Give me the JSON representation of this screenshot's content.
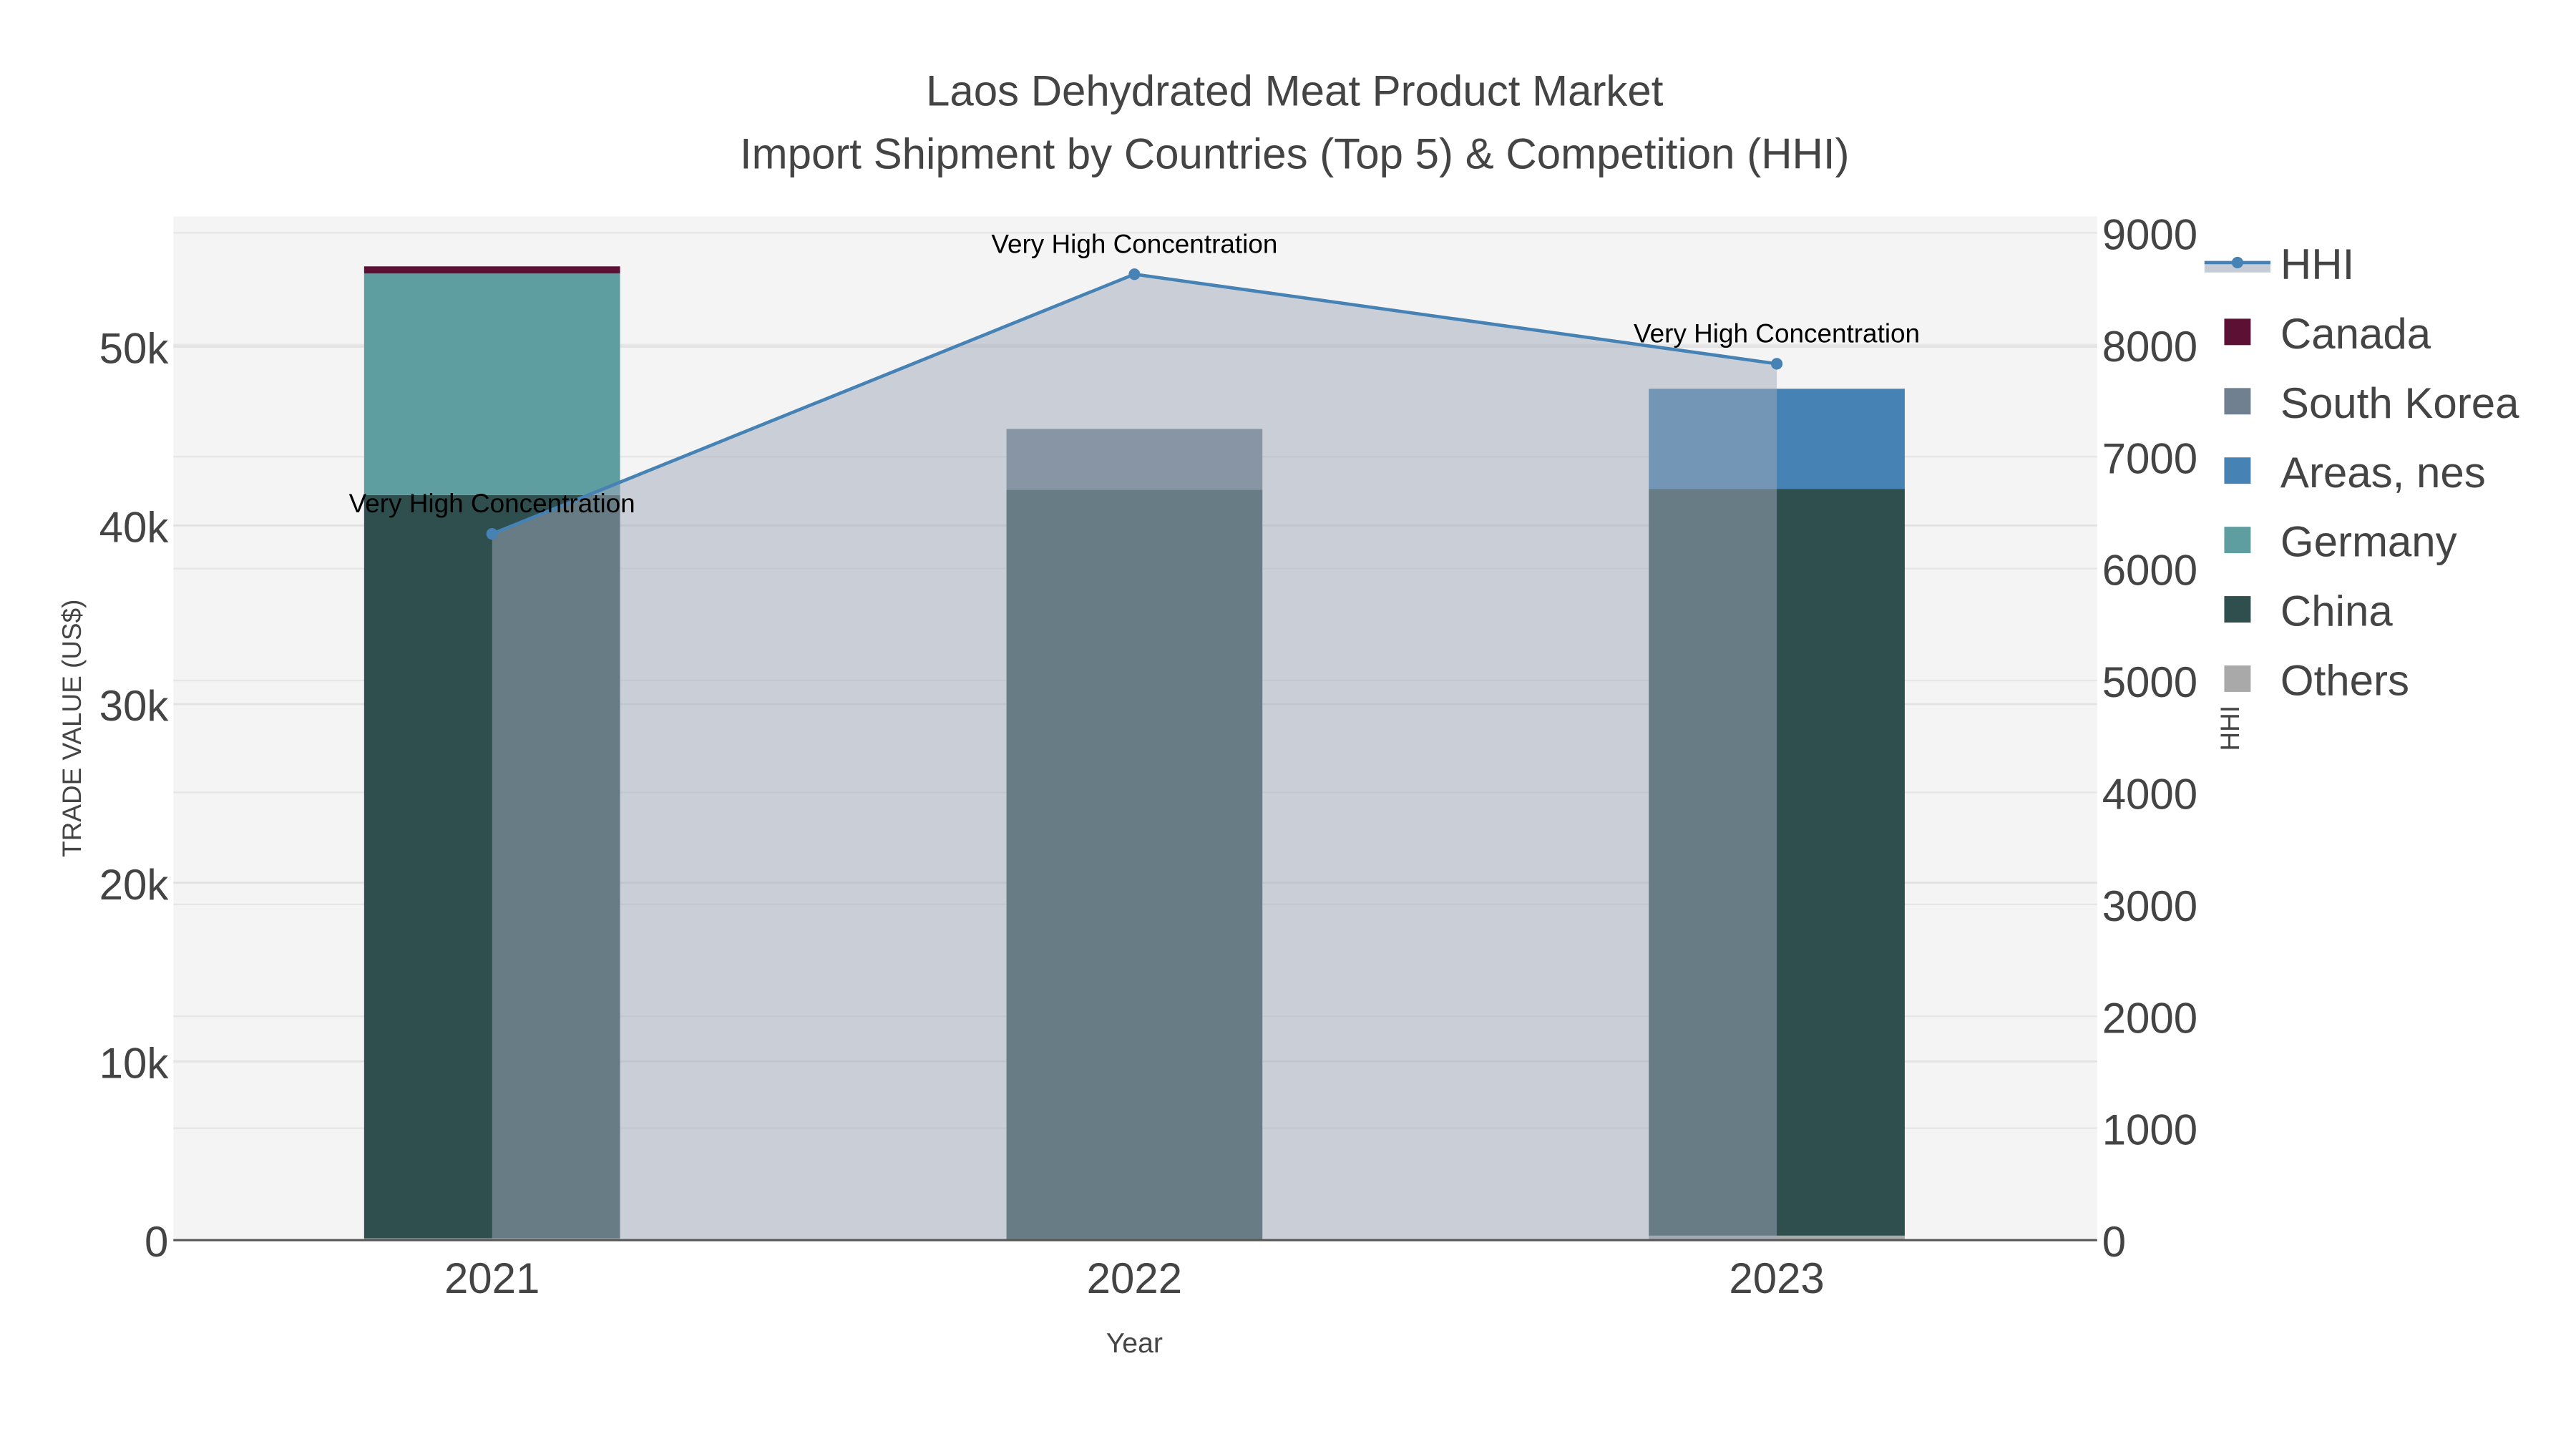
{
  "chart_data": {
    "type": "bar",
    "title": "Laos Dehydrated Meat Product Market",
    "subtitle": "Import Shipment by Countries (Top 5) & Competition (HHI)",
    "xlabel": "Year",
    "ylabel": "TRADE VALUE (US$)",
    "y2label": "HHI",
    "categories": [
      "2021",
      "2022",
      "2023"
    ],
    "ylim": [
      0,
      57000
    ],
    "y2lim": [
      0,
      9200
    ],
    "yticks": [
      0,
      10000,
      20000,
      30000,
      40000,
      50000
    ],
    "ytick_labels": [
      "0",
      "10k",
      "20k",
      "30k",
      "40k",
      "50k"
    ],
    "y2ticks": [
      0,
      1000,
      2000,
      3000,
      4000,
      5000,
      6000,
      7000,
      8000,
      9000
    ],
    "y2tick_labels": [
      "0",
      "1000",
      "2000",
      "3000",
      "4000",
      "5000",
      "6000",
      "7000",
      "8000",
      "9000"
    ],
    "legend_placement": "right",
    "series": [
      {
        "name": "Others",
        "color": "#a9a9a9",
        "values": [
          100,
          0,
          250
        ]
      },
      {
        "name": "China",
        "color": "#2f4f4f",
        "values": [
          41600,
          42000,
          41800
        ]
      },
      {
        "name": "Germany",
        "color": "#5f9ea0",
        "values": [
          12400,
          0,
          0
        ]
      },
      {
        "name": "Areas, nes",
        "color": "#4682b4",
        "values": [
          0,
          0,
          5600
        ]
      },
      {
        "name": "South Korea",
        "color": "#708090",
        "values": [
          0,
          3400,
          0
        ]
      },
      {
        "name": "Canada",
        "color": "#5c1033",
        "values": [
          400,
          0,
          0
        ]
      }
    ],
    "hhi": {
      "name": "HHI",
      "color": "#4682b4",
      "values": [
        6310,
        8630,
        7830
      ],
      "annotations": [
        "Very High Concentration",
        "Very High Concentration",
        "Very High Concentration"
      ]
    },
    "legend_order": [
      "HHI",
      "Canada",
      "South Korea",
      "Areas, nes",
      "Germany",
      "China",
      "Others"
    ]
  }
}
